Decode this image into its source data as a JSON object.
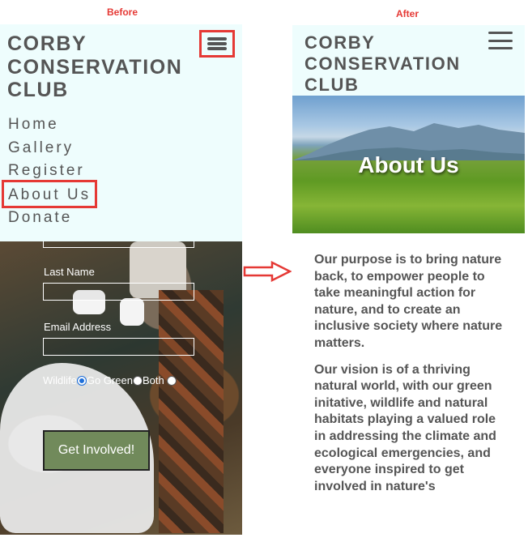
{
  "captions": {
    "before": "Before",
    "after": "After"
  },
  "before": {
    "title": "CORBY CONSERVATION CLUB",
    "nav": [
      "Home",
      "Gallery",
      "Register",
      "About Us",
      "Donate"
    ],
    "form": {
      "last_name_label": "Last Name",
      "email_label": "Email Address",
      "radio_options": [
        "Wildlife",
        "Go Green",
        "Both"
      ],
      "selected_option": "Wildlife",
      "submit_label": "Get Involved!"
    }
  },
  "after": {
    "title": "CORBY CONSERVATION CLUB",
    "hero_heading": "About Us",
    "paragraphs": [
      "Our purpose is to bring nature back, to empower people to take meaningful action for nature, and to create an inclusive society where nature matters.",
      "Our vision is of a thriving natural world, with our green initative, wildlife and natural habitats playing a valued role in addressing the climate and ecological emergencies, and everyone inspired to get involved in nature's"
    ]
  },
  "colors": {
    "highlight": "#e53935",
    "brand_text": "#555555",
    "header_bg": "#eefdfd",
    "button": "#718a5b"
  }
}
